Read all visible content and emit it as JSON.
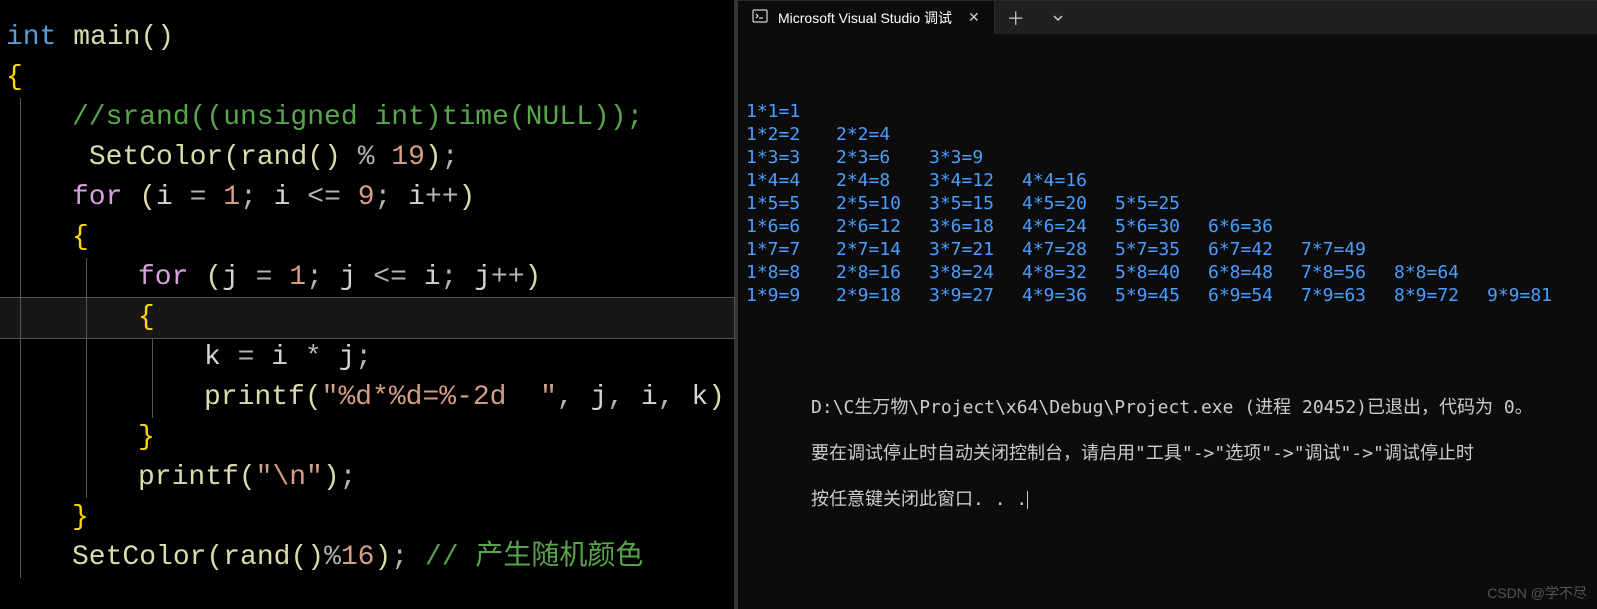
{
  "editor": {
    "lines": [
      {
        "indent": 0,
        "seg": [
          {
            "t": "int ",
            "c": "kw-type"
          },
          {
            "t": "main",
            "c": "fn-name"
          },
          {
            "t": "()",
            "c": "pn"
          }
        ]
      },
      {
        "indent": 0,
        "seg": [
          {
            "t": "{",
            "c": "br"
          }
        ]
      },
      {
        "indent": 1,
        "seg": [
          {
            "t": "//srand((unsigned int)time(NULL));",
            "c": "comment"
          }
        ]
      },
      {
        "indent": 1,
        "seg": [
          {
            "t": " ",
            "c": "ident"
          },
          {
            "t": "SetColor",
            "c": "fn-name"
          },
          {
            "t": "(",
            "c": "pn"
          },
          {
            "t": "rand",
            "c": "fn-name"
          },
          {
            "t": "() ",
            "c": "pn"
          },
          {
            "t": "% ",
            "c": "op"
          },
          {
            "t": "19",
            "c": "num"
          },
          {
            "t": ")",
            "c": "pn"
          },
          {
            "t": ";",
            "c": "op"
          }
        ]
      },
      {
        "indent": 1,
        "seg": [
          {
            "t": "for ",
            "c": "ctl"
          },
          {
            "t": "(",
            "c": "pn"
          },
          {
            "t": "i ",
            "c": "ident"
          },
          {
            "t": "= ",
            "c": "op"
          },
          {
            "t": "1",
            "c": "num"
          },
          {
            "t": "; ",
            "c": "op"
          },
          {
            "t": "i ",
            "c": "ident"
          },
          {
            "t": "<= ",
            "c": "op"
          },
          {
            "t": "9",
            "c": "num"
          },
          {
            "t": "; ",
            "c": "op"
          },
          {
            "t": "i",
            "c": "ident"
          },
          {
            "t": "++",
            "c": "op"
          },
          {
            "t": ")",
            "c": "pn"
          }
        ]
      },
      {
        "indent": 1,
        "seg": [
          {
            "t": "{",
            "c": "br"
          }
        ]
      },
      {
        "indent": 2,
        "seg": [
          {
            "t": "for ",
            "c": "ctl"
          },
          {
            "t": "(",
            "c": "pn"
          },
          {
            "t": "j ",
            "c": "ident"
          },
          {
            "t": "= ",
            "c": "op"
          },
          {
            "t": "1",
            "c": "num"
          },
          {
            "t": "; ",
            "c": "op"
          },
          {
            "t": "j ",
            "c": "ident"
          },
          {
            "t": "<= ",
            "c": "op"
          },
          {
            "t": "i",
            "c": "ident"
          },
          {
            "t": "; ",
            "c": "op"
          },
          {
            "t": "j",
            "c": "ident"
          },
          {
            "t": "++",
            "c": "op"
          },
          {
            "t": ")",
            "c": "pn"
          }
        ]
      },
      {
        "indent": 2,
        "hl": true,
        "seg": [
          {
            "t": "{",
            "c": "br"
          }
        ]
      },
      {
        "indent": 3,
        "seg": [
          {
            "t": "k ",
            "c": "ident"
          },
          {
            "t": "= ",
            "c": "op"
          },
          {
            "t": "i ",
            "c": "ident"
          },
          {
            "t": "* ",
            "c": "op"
          },
          {
            "t": "j",
            "c": "ident"
          },
          {
            "t": ";",
            "c": "op"
          }
        ]
      },
      {
        "indent": 3,
        "seg": [
          {
            "t": "printf",
            "c": "fn-name"
          },
          {
            "t": "(",
            "c": "pn"
          },
          {
            "t": "\"%d*%d=%-2d  \"",
            "c": "str"
          },
          {
            "t": ", ",
            "c": "op"
          },
          {
            "t": "j",
            "c": "ident"
          },
          {
            "t": ", ",
            "c": "op"
          },
          {
            "t": "i",
            "c": "ident"
          },
          {
            "t": ", ",
            "c": "op"
          },
          {
            "t": "k",
            "c": "ident"
          },
          {
            "t": ")",
            "c": "pn"
          }
        ]
      },
      {
        "indent": 2,
        "seg": [
          {
            "t": "}",
            "c": "br"
          }
        ]
      },
      {
        "indent": 2,
        "seg": [
          {
            "t": "printf",
            "c": "fn-name"
          },
          {
            "t": "(",
            "c": "pn"
          },
          {
            "t": "\"\\n\"",
            "c": "str"
          },
          {
            "t": ")",
            "c": "pn"
          },
          {
            "t": ";",
            "c": "op"
          }
        ]
      },
      {
        "indent": 1,
        "seg": [
          {
            "t": "}",
            "c": "br"
          }
        ]
      },
      {
        "indent": 1,
        "seg": [
          {
            "t": "SetColor",
            "c": "fn-name"
          },
          {
            "t": "(",
            "c": "pn"
          },
          {
            "t": "rand",
            "c": "fn-name"
          },
          {
            "t": "()",
            "c": "pn"
          },
          {
            "t": "%",
            "c": "op"
          },
          {
            "t": "16",
            "c": "num"
          },
          {
            "t": ")",
            "c": "pn"
          },
          {
            "t": "; ",
            "c": "op"
          },
          {
            "t": "// 产生随机颜色",
            "c": "comment"
          }
        ]
      }
    ]
  },
  "console": {
    "tab_title": "Microsoft Visual Studio 调试",
    "mult_table": [
      [
        "1*1=1"
      ],
      [
        "1*2=2",
        "2*2=4"
      ],
      [
        "1*3=3",
        "2*3=6",
        "3*3=9"
      ],
      [
        "1*4=4",
        "2*4=8",
        "3*4=12",
        "4*4=16"
      ],
      [
        "1*5=5",
        "2*5=10",
        "3*5=15",
        "4*5=20",
        "5*5=25"
      ],
      [
        "1*6=6",
        "2*6=12",
        "3*6=18",
        "4*6=24",
        "5*6=30",
        "6*6=36"
      ],
      [
        "1*7=7",
        "2*7=14",
        "3*7=21",
        "4*7=28",
        "5*7=35",
        "6*7=42",
        "7*7=49"
      ],
      [
        "1*8=8",
        "2*8=16",
        "3*8=24",
        "4*8=32",
        "5*8=40",
        "6*8=48",
        "7*8=56",
        "8*8=64"
      ],
      [
        "1*9=9",
        "2*9=18",
        "3*9=27",
        "4*9=36",
        "5*9=45",
        "6*9=54",
        "7*9=63",
        "8*9=72",
        "9*9=81"
      ]
    ],
    "msg1": "D:\\C生万物\\Project\\x64\\Debug\\Project.exe (进程 20452)已退出，代码为 0。",
    "msg2": "要在调试停止时自动关闭控制台，请启用\"工具\"->\"选项\"->\"调试\"->\"调试停止时",
    "msg3": "按任意键关闭此窗口. . ."
  },
  "watermark": "CSDN @学不尽"
}
